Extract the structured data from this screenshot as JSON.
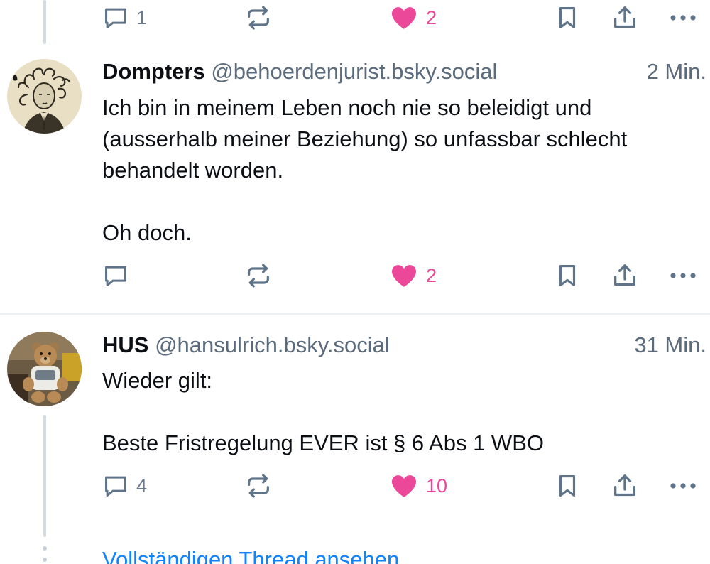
{
  "posts": [
    {
      "actions": {
        "reply_count": "1",
        "repost_count": "",
        "like_count": "2",
        "liked": true
      }
    },
    {
      "author": {
        "display_name": "Dompters",
        "handle": "@behoerdenjurist.bsky.social"
      },
      "timestamp": "2 Min.",
      "text": "Ich bin in meinem Leben noch nie so beleidigt und (ausserhalb meiner Beziehung) so unfassbar schlecht behandelt worden.\n\nOh doch.",
      "actions": {
        "reply_count": "",
        "repost_count": "",
        "like_count": "2",
        "liked": true
      }
    },
    {
      "author": {
        "display_name": "HUS",
        "handle": "@hansulrich.bsky.social"
      },
      "timestamp": "31 Min.",
      "text": "Wieder gilt:\n\nBeste Fristregelung EVER ist § 6 Abs 1 WBO",
      "actions": {
        "reply_count": "4",
        "repost_count": "",
        "like_count": "10",
        "liked": true
      }
    }
  ],
  "thread_link": "Vollständigen Thread ansehen",
  "colors": {
    "like": "#ec4899",
    "icon": "#5f7489",
    "link": "#1083fe",
    "handle": "#5b6b7c",
    "divider": "#eef1f4"
  }
}
